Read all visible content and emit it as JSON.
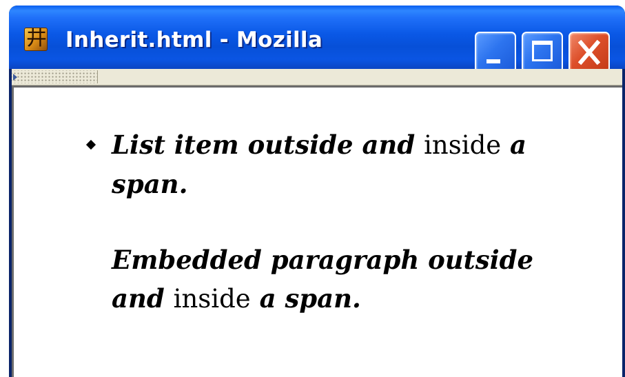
{
  "window": {
    "title": "Inherit.html - Mozilla",
    "app_icon_glyph": "井",
    "titlebar_color": "#0a58e6",
    "close_button_color": "#dd4f2a"
  },
  "toolbar": {
    "grip_icon": "toolbar-grip-icon"
  },
  "content": {
    "list_item": {
      "before_span": "List item outside and ",
      "span_text": "inside",
      "after_span": " a span."
    },
    "paragraph": {
      "before_span": "Embedded paragraph outside and ",
      "span_text": "inside",
      "after_span": " a span."
    }
  }
}
